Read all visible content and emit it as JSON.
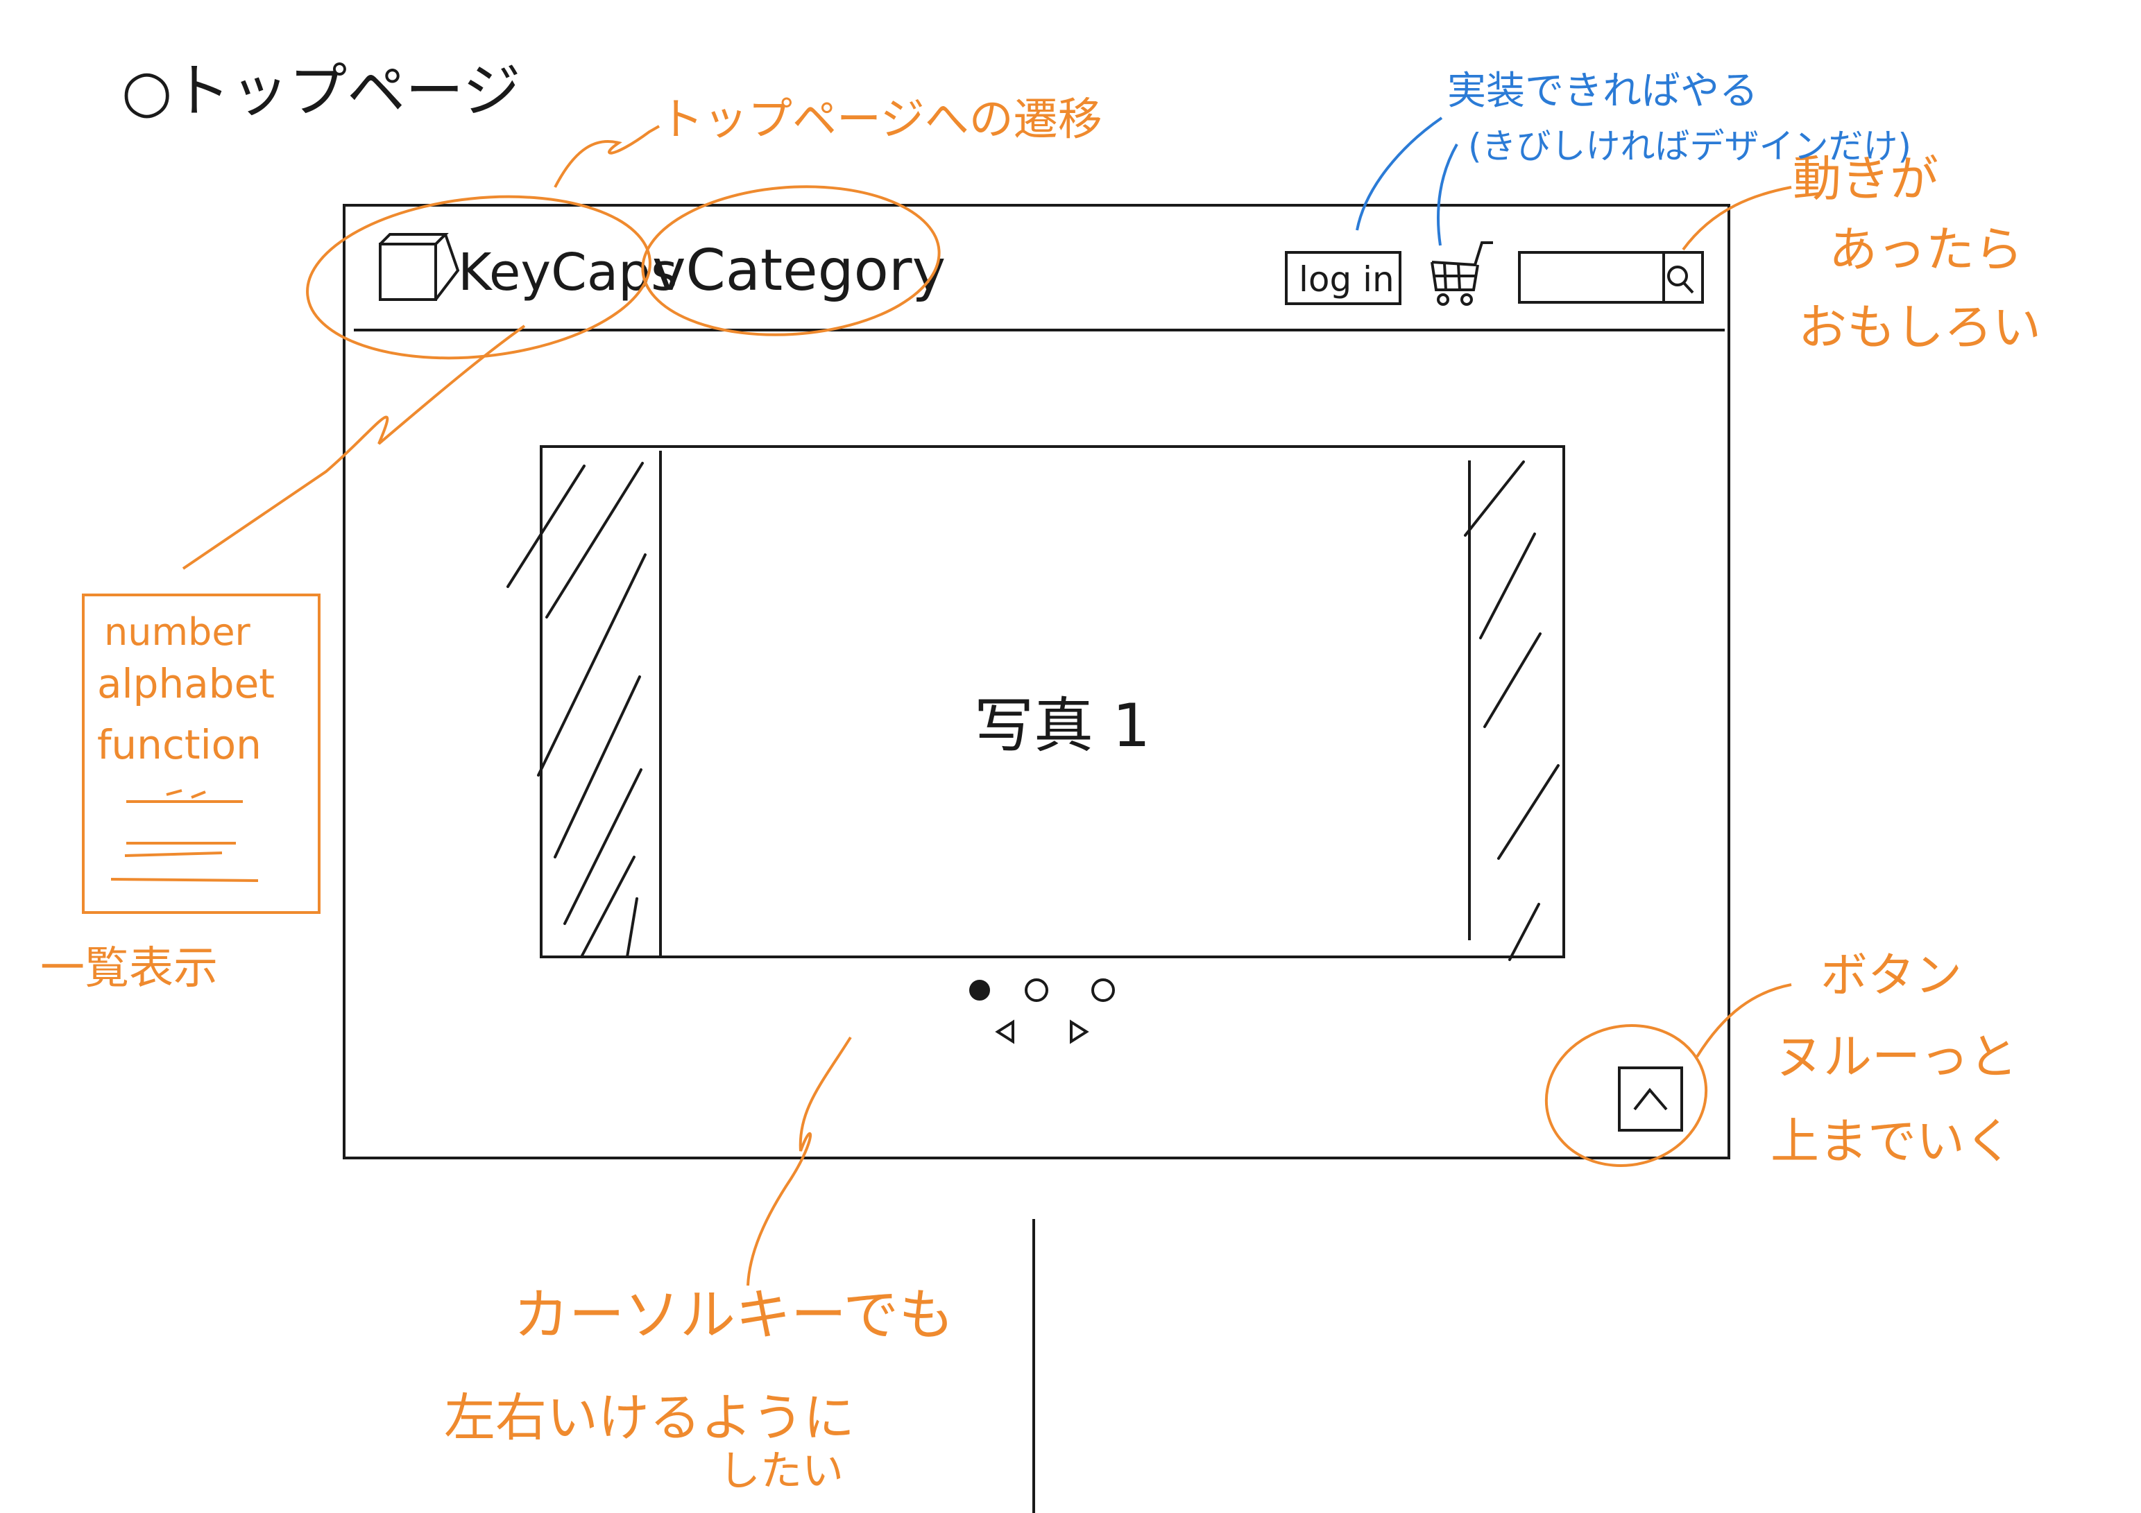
{
  "page_heading": "○トップページ",
  "header": {
    "logo_label": "KeyCaps",
    "category_label": "vCategory",
    "login_label": "log in"
  },
  "carousel": {
    "photo_label": "写真 1"
  },
  "notes": {
    "top_page_nav": "トップページへの遷移",
    "implement_if_possible": "実装できればやる",
    "design_only_if_hard": "(きびしければデザインだけ)",
    "animation_interesting": [
      "動きが",
      "あったら",
      "おもしろい"
    ],
    "category_dropdown_items": [
      "number",
      "alphabet",
      "function"
    ],
    "list_display": "一覧表示",
    "button_scroll_top": [
      "ボタン",
      "ヌルーっと",
      "上までいく"
    ],
    "cursor_keys": [
      "カーソルキーでも",
      "左右いけるように",
      "したい"
    ]
  },
  "colors": {
    "ink": "#1a1a1a",
    "orange": "#ef8a2e",
    "blue": "#2b7bd6"
  }
}
